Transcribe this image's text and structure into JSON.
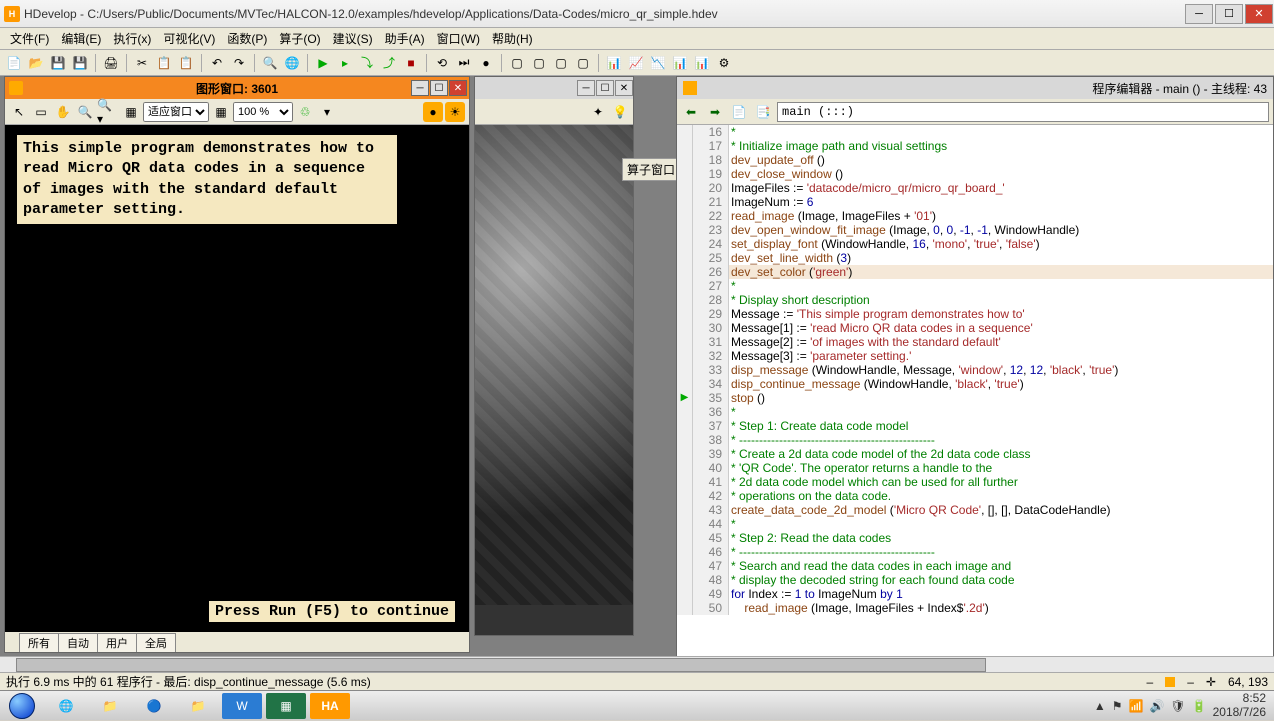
{
  "window": {
    "title": "HDevelop - C:/Users/Public/Documents/MVTec/HALCON-12.0/examples/hdevelop/Applications/Data-Codes/micro_qr_simple.hdev"
  },
  "menu": {
    "file": "文件(F)",
    "edit": "编辑(E)",
    "execute": "执行(x)",
    "visualize": "可视化(V)",
    "functions": "函数(P)",
    "operators": "算子(O)",
    "suggestions": "建议(S)",
    "assistant": "助手(A)",
    "window": "窗口(W)",
    "help": "帮助(H)"
  },
  "graphics": {
    "title": "图形窗口: 3601",
    "fit_label": "适应窗口",
    "zoom_label": "100 %",
    "overlay": "This simple program demonstrates how to read Micro QR data codes in a sequence of images with the standard default parameter setting.",
    "continue": "Press Run (F5) to continue",
    "tabs": {
      "all": "所有",
      "auto": "自动",
      "user": "用户",
      "global": "全局"
    }
  },
  "operator_panel": {
    "title": "算子窗口"
  },
  "editor": {
    "title": "程序编辑器 - main () - 主线程: 43",
    "path": "main (:::)",
    "lines": [
      {
        "n": 16,
        "t": "*",
        "cls": "cm"
      },
      {
        "n": 17,
        "t": "* Initialize image path and visual settings",
        "cls": "cm"
      },
      {
        "n": 18,
        "html": "<span class='fn'>dev_update_off</span> ()"
      },
      {
        "n": 19,
        "html": "<span class='fn'>dev_close_window</span> ()"
      },
      {
        "n": 20,
        "html": "<span class='id'>ImageFiles</span> := <span class='st'>'datacode/micro_qr/micro_qr_board_'</span>"
      },
      {
        "n": 21,
        "html": "<span class='id'>ImageNum</span> := <span class='nm'>6</span>"
      },
      {
        "n": 22,
        "html": "<span class='fn'>read_image</span> (Image, ImageFiles + <span class='st'>'01'</span>)"
      },
      {
        "n": 23,
        "html": "<span class='fn'>dev_open_window_fit_image</span> (Image, <span class='nm'>0</span>, <span class='nm'>0</span>, <span class='nm'>-1</span>, <span class='nm'>-1</span>, WindowHandle)"
      },
      {
        "n": 24,
        "html": "<span class='fn'>set_display_font</span> (WindowHandle, <span class='nm'>16</span>, <span class='st'>'mono'</span>, <span class='st'>'true'</span>, <span class='st'>'false'</span>)"
      },
      {
        "n": 25,
        "html": "<span class='fn'>dev_set_line_width</span> (<span class='nm'>3</span>)"
      },
      {
        "n": 26,
        "html": "<span class='fn'>dev_set_color</span> (<span class='st'>'green'</span>)",
        "hl": true
      },
      {
        "n": 27,
        "t": "*",
        "cls": "cm"
      },
      {
        "n": 28,
        "t": "* Display short description",
        "cls": "cm"
      },
      {
        "n": 29,
        "html": "<span class='id'>Message</span> := <span class='st'>'This simple program demonstrates how to'</span>"
      },
      {
        "n": 30,
        "html": "<span class='id'>Message[1]</span> := <span class='st'>'read Micro QR data codes in a sequence'</span>"
      },
      {
        "n": 31,
        "html": "<span class='id'>Message[2]</span> := <span class='st'>'of images with the standard default'</span>"
      },
      {
        "n": 32,
        "html": "<span class='id'>Message[3]</span> := <span class='st'>'parameter setting.'</span>"
      },
      {
        "n": 33,
        "html": "<span class='fn'>disp_message</span> (WindowHandle, Message, <span class='st'>'window'</span>, <span class='nm'>12</span>, <span class='nm'>12</span>, <span class='st'>'black'</span>, <span class='st'>'true'</span>)"
      },
      {
        "n": 34,
        "html": "<span class='fn'>disp_continue_message</span> (WindowHandle, <span class='st'>'black'</span>, <span class='st'>'true'</span>)"
      },
      {
        "n": 35,
        "html": "<span class='fn'>stop</span> ()",
        "marker": "▶"
      },
      {
        "n": 36,
        "t": "*",
        "cls": "cm"
      },
      {
        "n": 37,
        "t": "* Step 1: Create data code model",
        "cls": "cm"
      },
      {
        "n": 38,
        "t": "* -------------------------------------------------",
        "cls": "cm"
      },
      {
        "n": 39,
        "t": "* Create a 2d data code model of the 2d data code class",
        "cls": "cm"
      },
      {
        "n": 40,
        "t": "* 'QR Code'. The operator returns a handle to the",
        "cls": "cm"
      },
      {
        "n": 41,
        "t": "* 2d data code model which can be used for all further",
        "cls": "cm"
      },
      {
        "n": 42,
        "t": "* operations on the data code.",
        "cls": "cm"
      },
      {
        "n": 43,
        "html": "<span class='fn'>create_data_code_2d_model</span> (<span class='st'>'Micro QR Code'</span>, [], [], DataCodeHandle)"
      },
      {
        "n": 44,
        "t": "*",
        "cls": "cm"
      },
      {
        "n": 45,
        "t": "* Step 2: Read the data codes",
        "cls": "cm"
      },
      {
        "n": 46,
        "t": "* -------------------------------------------------",
        "cls": "cm"
      },
      {
        "n": 47,
        "t": "* Search and read the data codes in each image and",
        "cls": "cm"
      },
      {
        "n": 48,
        "t": "* display the decoded string for each found data code",
        "cls": "cm"
      },
      {
        "n": 49,
        "html": "<span class='kw'>for</span> Index := <span class='nm'>1</span> <span class='kw'>to</span> ImageNum <span class='kw'>by</span> <span class='nm'>1</span>"
      },
      {
        "n": 50,
        "html": "    <span class='fn'>read_image</span> (Image, ImageFiles + Index$<span class='st'>'.2d'</span>)"
      }
    ]
  },
  "status": {
    "left": "执行 6.9 ms 中的 61 程序行 - 最后: disp_continue_message (5.6 ms)",
    "coords": "64, 193"
  },
  "taskbar": {
    "time": "8:52",
    "date": "2018/7/26"
  }
}
